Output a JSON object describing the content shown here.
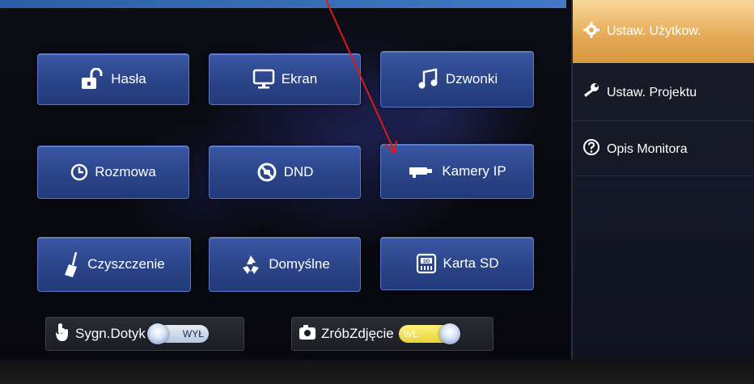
{
  "settings_grid": {
    "buttons": [
      {
        "id": "hasla",
        "label": "Hasła",
        "icon": "unlock-icon"
      },
      {
        "id": "ekran",
        "label": "Ekran",
        "icon": "monitor-icon"
      },
      {
        "id": "dzwonki",
        "label": "Dzwonki",
        "icon": "music-note-icon"
      },
      {
        "id": "rozmowa",
        "label": "Rozmowa",
        "icon": "clock-icon"
      },
      {
        "id": "dnd",
        "label": "DND",
        "icon": "do-not-disturb-icon"
      },
      {
        "id": "kamery",
        "label": "Kamery IP",
        "icon": "ip-camera-icon"
      },
      {
        "id": "czyszczenie",
        "label": "Czyszczenie",
        "icon": "broom-icon"
      },
      {
        "id": "domyslne",
        "label": "Domyślne",
        "icon": "recycle-icon"
      },
      {
        "id": "karta",
        "label": "Karta SD",
        "icon": "sd-card-icon"
      }
    ]
  },
  "toggles": {
    "touch_signal": {
      "label": "Sygn.Dotyk",
      "state_label": "WYŁ",
      "state": "off",
      "icon": "touch-hand-icon"
    },
    "take_photo": {
      "label": "ZróbZdjęcie",
      "state_label": "WŁ",
      "state": "on",
      "icon": "camera-icon"
    }
  },
  "sidebar": {
    "items": [
      {
        "label": "Ustaw. Użytkow.",
        "icon": "gear-icon",
        "active": true
      },
      {
        "label": "Ustaw. Projektu",
        "icon": "wrench-icon",
        "active": false
      },
      {
        "label": "Opis Monitora",
        "icon": "help-circle-icon",
        "active": false
      }
    ]
  },
  "colors": {
    "button_blue": "#2a4488",
    "sidebar_active": "#e4a954",
    "toggle_on": "#e6d43a",
    "annotation_arrow": "#e01818"
  }
}
